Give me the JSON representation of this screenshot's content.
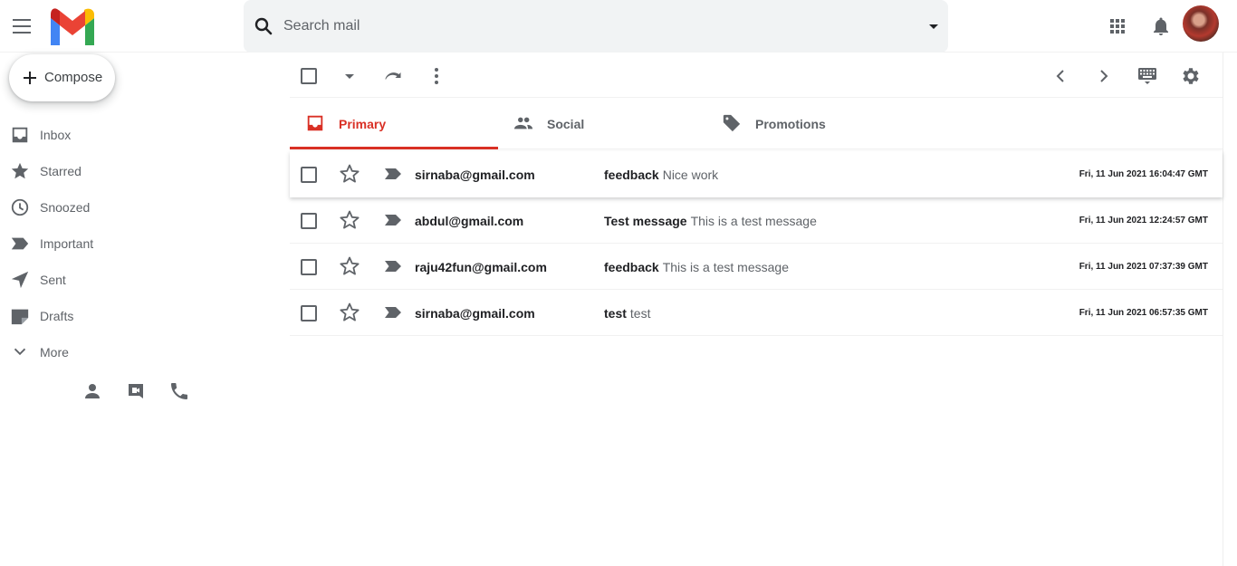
{
  "header": {
    "search_placeholder": "Search mail"
  },
  "sidebar": {
    "compose_label": "Compose",
    "items": [
      {
        "label": "Inbox",
        "icon": "inbox-icon"
      },
      {
        "label": "Starred",
        "icon": "star-icon"
      },
      {
        "label": "Snoozed",
        "icon": "clock-icon"
      },
      {
        "label": "Important",
        "icon": "important-icon"
      },
      {
        "label": "Sent",
        "icon": "send-icon"
      },
      {
        "label": "Drafts",
        "icon": "draft-icon"
      },
      {
        "label": "More",
        "icon": "chevron-down-icon"
      }
    ]
  },
  "tabs": [
    {
      "label": "Primary",
      "icon": "inbox-tab-icon",
      "active": true
    },
    {
      "label": "Social",
      "icon": "people-icon",
      "active": false
    },
    {
      "label": "Promotions",
      "icon": "tag-icon",
      "active": false
    }
  ],
  "messages": [
    {
      "from": "sirnaba@gmail.com",
      "subject": "feedback",
      "snippet": "Nice work",
      "date": "Fri, 11 Jun 2021 16:04:47 GMT"
    },
    {
      "from": "abdul@gmail.com",
      "subject": "Test message",
      "snippet": "This is a test message",
      "date": "Fri, 11 Jun 2021 12:24:57 GMT"
    },
    {
      "from": "raju42fun@gmail.com",
      "subject": "feedback",
      "snippet": "This is a test message",
      "date": "Fri, 11 Jun 2021 07:37:39 GMT"
    },
    {
      "from": "sirnaba@gmail.com",
      "subject": "test",
      "snippet": "test",
      "date": "Fri, 11 Jun 2021 06:57:35 GMT"
    }
  ],
  "colors": {
    "accent_red": "#d93025",
    "icon_gray": "#5f6368",
    "search_bg": "#f1f3f4"
  }
}
